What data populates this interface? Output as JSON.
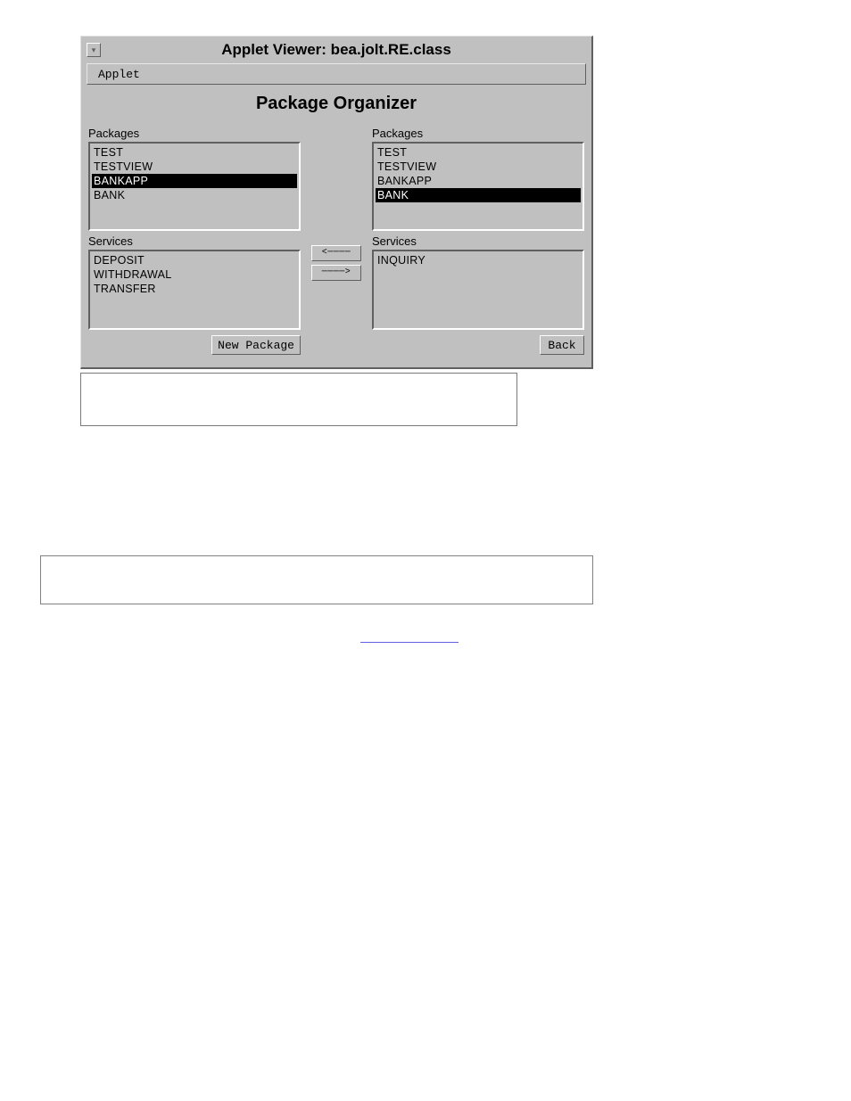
{
  "applet": {
    "title": "Applet Viewer: bea.jolt.RE.class",
    "menu": {
      "applet": "Applet"
    },
    "panel_title": "Package Organizer",
    "labels": {
      "packages": "Packages",
      "services": "Services"
    },
    "left": {
      "packages": [
        {
          "text": "TEST",
          "selected": false
        },
        {
          "text": "TESTVIEW",
          "selected": false
        },
        {
          "text": "BANKAPP",
          "selected": true
        },
        {
          "text": "BANK",
          "selected": false
        }
      ],
      "services": [
        {
          "text": "DEPOSIT",
          "selected": false
        },
        {
          "text": "WITHDRAWAL",
          "selected": false
        },
        {
          "text": "TRANSFER",
          "selected": false
        }
      ]
    },
    "right": {
      "packages": [
        {
          "text": "TEST",
          "selected": false
        },
        {
          "text": "TESTVIEW",
          "selected": false
        },
        {
          "text": "BANKAPP",
          "selected": false
        },
        {
          "text": "BANK",
          "selected": true
        }
      ],
      "services": [
        {
          "text": "INQUIRY",
          "selected": false
        }
      ]
    },
    "arrows": {
      "left": "<────",
      "right": "────>"
    },
    "buttons": {
      "new_package": "New Package",
      "back": "Back"
    }
  },
  "doc": {
    "link_placeholder": ""
  }
}
